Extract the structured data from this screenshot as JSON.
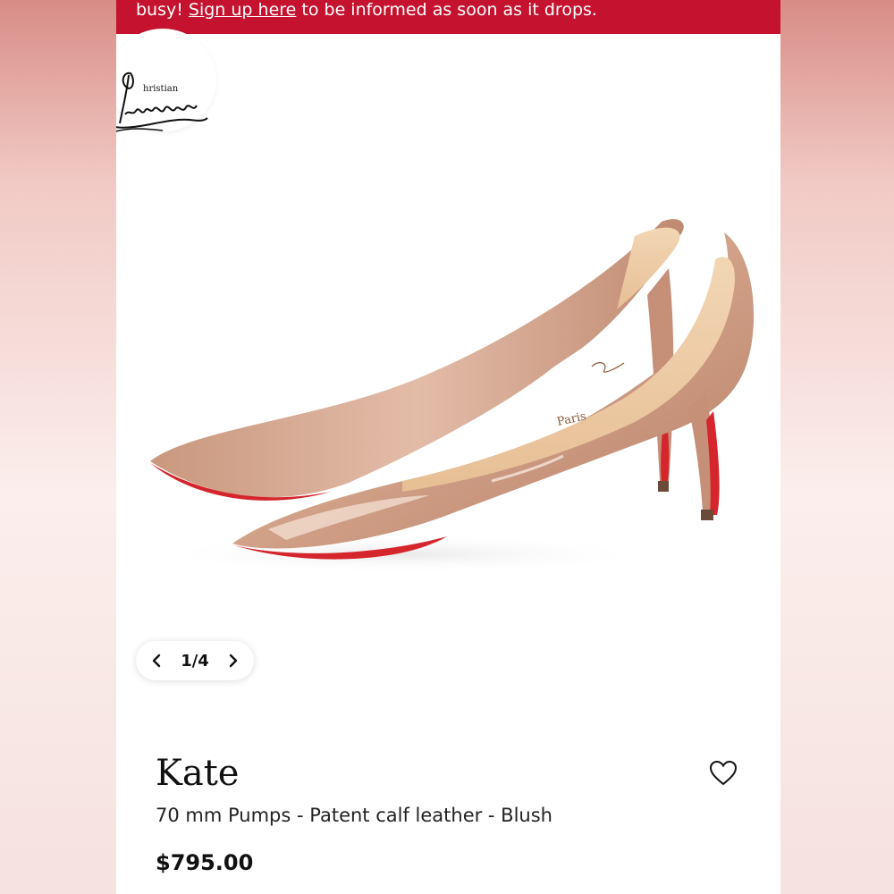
{
  "banner": {
    "prefix": "busy! ",
    "link": "Sign up here",
    "suffix": " to be informed as soon as it drops."
  },
  "brand": {
    "logo_text": "Christian Louboutin"
  },
  "gallery": {
    "counter": "1/4",
    "prev_icon": "chevron-left-icon",
    "next_icon": "chevron-right-icon"
  },
  "shoe": {
    "insole_text": "Paris"
  },
  "product": {
    "name": "Kate",
    "description": "70 mm Pumps - Patent calf leather - Blush",
    "price": "$795.00",
    "wishlist_icon": "heart-icon"
  },
  "colors": {
    "banner": "#c4122f",
    "shoe_blush": "#d3a48b",
    "sole_red": "#d4262c"
  }
}
